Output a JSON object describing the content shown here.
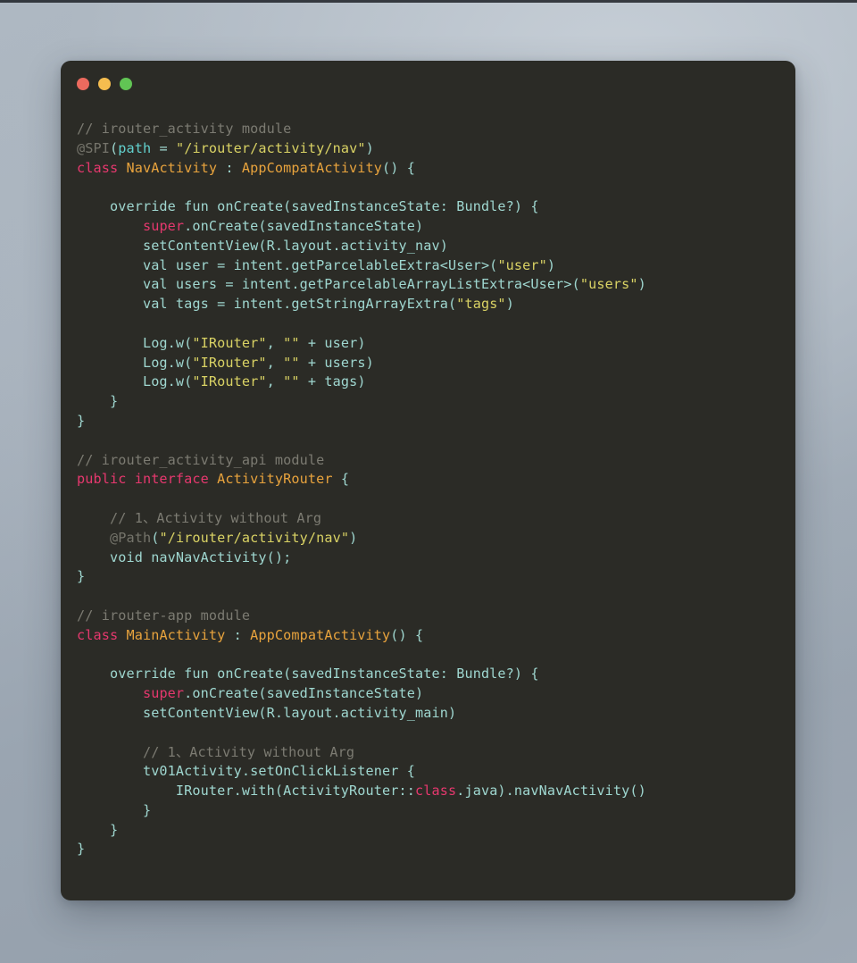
{
  "window": {
    "name": "code-snippet-window",
    "background_color": "#2b2b26",
    "traffic_lights": [
      {
        "name": "close-button",
        "label": "Close",
        "color": "#ec6a5e"
      },
      {
        "name": "minimize-button",
        "label": "Minimize",
        "color": "#f5bd4f"
      },
      {
        "name": "maximize-button",
        "label": "Maximize",
        "color": "#61c554"
      }
    ]
  },
  "desktop": {
    "background_top": "#adb7c1",
    "background_bottom": "#9fa9b4"
  },
  "syntax_colors": {
    "comment": "#7c7b72",
    "annotation": "#75746b",
    "keyword": "#e6386e",
    "type": "#e8a33d",
    "identifier": "#9fd7d0",
    "string": "#d9d264",
    "property": "#62d0cd"
  },
  "code": {
    "language": "Kotlin / Java",
    "lines": [
      "// irouter_activity module",
      "@SPI(path = \"/irouter/activity/nav\")",
      "class NavActivity : AppCompatActivity() {",
      "",
      "    override fun onCreate(savedInstanceState: Bundle?) {",
      "        super.onCreate(savedInstanceState)",
      "        setContentView(R.layout.activity_nav)",
      "        val user = intent.getParcelableExtra<User>(\"user\")",
      "        val users = intent.getParcelableArrayListExtra<User>(\"users\")",
      "        val tags = intent.getStringArrayExtra(\"tags\")",
      "",
      "        Log.w(\"IRouter\", \"\" + user)",
      "        Log.w(\"IRouter\", \"\" + users)",
      "        Log.w(\"IRouter\", \"\" + tags)",
      "    }",
      "}",
      "",
      "// irouter_activity_api module",
      "public interface ActivityRouter {",
      "",
      "    // 1、Activity without Arg",
      "    @Path(\"/irouter/activity/nav\")",
      "    void navNavActivity();",
      "}",
      "",
      "// irouter-app module",
      "class MainActivity : AppCompatActivity() {",
      "",
      "    override fun onCreate(savedInstanceState: Bundle?) {",
      "        super.onCreate(savedInstanceState)",
      "        setContentView(R.layout.activity_main)",
      "",
      "        // 1、Activity without Arg",
      "        tv01Activity.setOnClickListener {",
      "            IRouter.with(ActivityRouter::class.java).navNavActivity()",
      "        }",
      "    }",
      "}"
    ],
    "highlighted": [
      [
        [
          "com",
          "// irouter_activity module"
        ]
      ],
      [
        [
          "anno",
          "@SPI"
        ],
        [
          "id",
          "("
        ],
        [
          "prop",
          "path"
        ],
        [
          "id",
          " = "
        ],
        [
          "str",
          "\"/irouter/activity/nav\""
        ],
        [
          "id",
          ")"
        ]
      ],
      [
        [
          "kw",
          "class"
        ],
        [
          "id",
          " "
        ],
        [
          "type",
          "NavActivity"
        ],
        [
          "id",
          " : "
        ],
        [
          "type",
          "AppCompatActivity"
        ],
        [
          "id",
          "() {"
        ]
      ],
      [],
      [
        [
          "id",
          "    override fun onCreate(savedInstanceState: Bundle?) {"
        ]
      ],
      [
        [
          "id",
          "        "
        ],
        [
          "kw",
          "super"
        ],
        [
          "id",
          ".onCreate(savedInstanceState)"
        ]
      ],
      [
        [
          "id",
          "        setContentView(R.layout.activity_nav)"
        ]
      ],
      [
        [
          "id",
          "        val user = intent.getParcelableExtra<User>("
        ],
        [
          "str",
          "\"user\""
        ],
        [
          "id",
          ")"
        ]
      ],
      [
        [
          "id",
          "        val users = intent.getParcelableArrayListExtra<User>("
        ],
        [
          "str",
          "\"users\""
        ],
        [
          "id",
          ")"
        ]
      ],
      [
        [
          "id",
          "        val tags = intent.getStringArrayExtra("
        ],
        [
          "str",
          "\"tags\""
        ],
        [
          "id",
          ")"
        ]
      ],
      [],
      [
        [
          "id",
          "        Log.w("
        ],
        [
          "str",
          "\"IRouter\""
        ],
        [
          "id",
          ", "
        ],
        [
          "str",
          "\"\""
        ],
        [
          "id",
          " + user)"
        ]
      ],
      [
        [
          "id",
          "        Log.w("
        ],
        [
          "str",
          "\"IRouter\""
        ],
        [
          "id",
          ", "
        ],
        [
          "str",
          "\"\""
        ],
        [
          "id",
          " + users)"
        ]
      ],
      [
        [
          "id",
          "        Log.w("
        ],
        [
          "str",
          "\"IRouter\""
        ],
        [
          "id",
          ", "
        ],
        [
          "str",
          "\"\""
        ],
        [
          "id",
          " + tags)"
        ]
      ],
      [
        [
          "id",
          "    }"
        ]
      ],
      [
        [
          "id",
          "}"
        ]
      ],
      [],
      [
        [
          "com",
          "// irouter_activity_api module"
        ]
      ],
      [
        [
          "kw",
          "public interface"
        ],
        [
          "id",
          " "
        ],
        [
          "type",
          "ActivityRouter"
        ],
        [
          "id",
          " {"
        ]
      ],
      [],
      [
        [
          "com",
          "    // 1、Activity without Arg"
        ]
      ],
      [
        [
          "id",
          "    "
        ],
        [
          "anno",
          "@Path"
        ],
        [
          "id",
          "("
        ],
        [
          "str",
          "\"/irouter/activity/nav\""
        ],
        [
          "id",
          ")"
        ]
      ],
      [
        [
          "id",
          "    void navNavActivity();"
        ]
      ],
      [
        [
          "id",
          "}"
        ]
      ],
      [],
      [
        [
          "com",
          "// irouter-app module"
        ]
      ],
      [
        [
          "kw",
          "class"
        ],
        [
          "id",
          " "
        ],
        [
          "type",
          "MainActivity"
        ],
        [
          "id",
          " : "
        ],
        [
          "type",
          "AppCompatActivity"
        ],
        [
          "id",
          "() {"
        ]
      ],
      [],
      [
        [
          "id",
          "    override fun onCreate(savedInstanceState: Bundle?) {"
        ]
      ],
      [
        [
          "id",
          "        "
        ],
        [
          "kw",
          "super"
        ],
        [
          "id",
          ".onCreate(savedInstanceState)"
        ]
      ],
      [
        [
          "id",
          "        setContentView(R.layout.activity_main)"
        ]
      ],
      [],
      [
        [
          "com",
          "        // 1、Activity without Arg"
        ]
      ],
      [
        [
          "id",
          "        tv01Activity.setOnClickListener {"
        ]
      ],
      [
        [
          "id",
          "            IRouter.with(ActivityRouter::"
        ],
        [
          "kw",
          "class"
        ],
        [
          "id",
          ".java).navNavActivity()"
        ]
      ],
      [
        [
          "id",
          "        }"
        ]
      ],
      [
        [
          "id",
          "    }"
        ]
      ],
      [
        [
          "id",
          "}"
        ]
      ]
    ]
  }
}
